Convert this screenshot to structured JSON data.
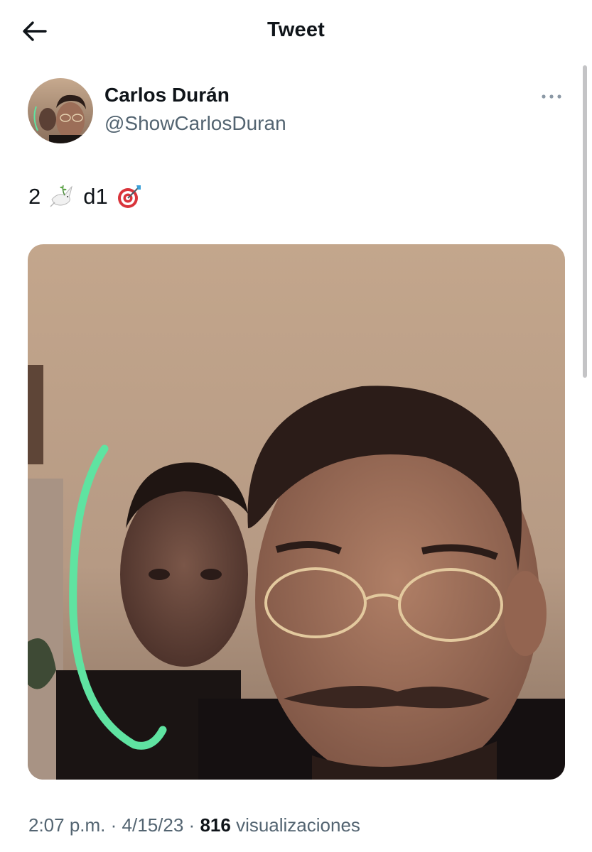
{
  "header": {
    "title": "Tweet",
    "back_icon": "arrow-left-icon"
  },
  "author": {
    "name": "Carlos Durán",
    "handle": "@ShowCarlosDuran",
    "more_icon": "more-horizontal-icon"
  },
  "tweet": {
    "text_parts": [
      "2",
      "d1"
    ],
    "emojis": [
      "dove-icon",
      "direct-hit-icon"
    ]
  },
  "media": {
    "type": "photo",
    "accent_stroke_color": "#5fe3a1"
  },
  "meta": {
    "time": "2:07 p.m.",
    "separator": "·",
    "date": "4/15/23",
    "views_count": "816",
    "views_label": "visualizaciones"
  },
  "colors": {
    "text_primary": "#0f1419",
    "text_secondary": "#536471",
    "background": "#ffffff"
  }
}
